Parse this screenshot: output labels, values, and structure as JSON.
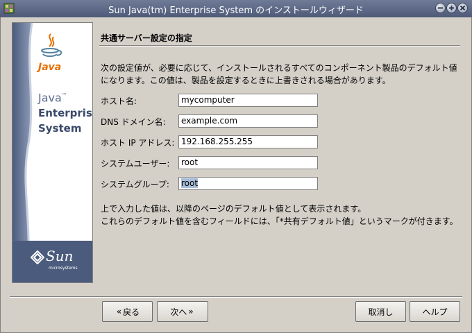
{
  "window": {
    "title": "Sun Java(tm) Enterprise System のインストールウィザード"
  },
  "banner": {
    "logo_java": "Java",
    "product_line1": "Java",
    "product_tm": "™",
    "product_line2": "Enterprise",
    "product_line3": "System",
    "vendor": "Sun",
    "vendor_sub": "microsystems"
  },
  "page": {
    "title": "共通サーバー設定の指定",
    "description": [
      "次の設定値が、必要に応じて、インストールされるすべてのコンポーネント製品のデフォルト値",
      "になります。この値は、製品を設定するときに上書きされる場合があります。"
    ],
    "fields": [
      {
        "label": "ホスト名:",
        "value": "mycomputer"
      },
      {
        "label": "DNS ドメイン名:",
        "value": "example.com"
      },
      {
        "label": "ホスト IP アドレス:",
        "value": "192.168.255.255"
      },
      {
        "label": "システムユーザー:",
        "value": "root"
      },
      {
        "label": "システムグループ:",
        "value": "root"
      }
    ],
    "note": [
      "上で入力した値は、以降のページのデフォルト値として表示されます。",
      "これらのデフォルト値を含むフィールドには、「*共有デフォルト値」というマークが付きます。"
    ]
  },
  "buttons": {
    "back": "戻る",
    "next": "次へ",
    "cancel": "取消し",
    "help": "ヘルプ"
  },
  "colors": {
    "titlebar": "#5a6684",
    "banner_blue": "#4b5b7d",
    "selection": "#a8bcd8"
  }
}
